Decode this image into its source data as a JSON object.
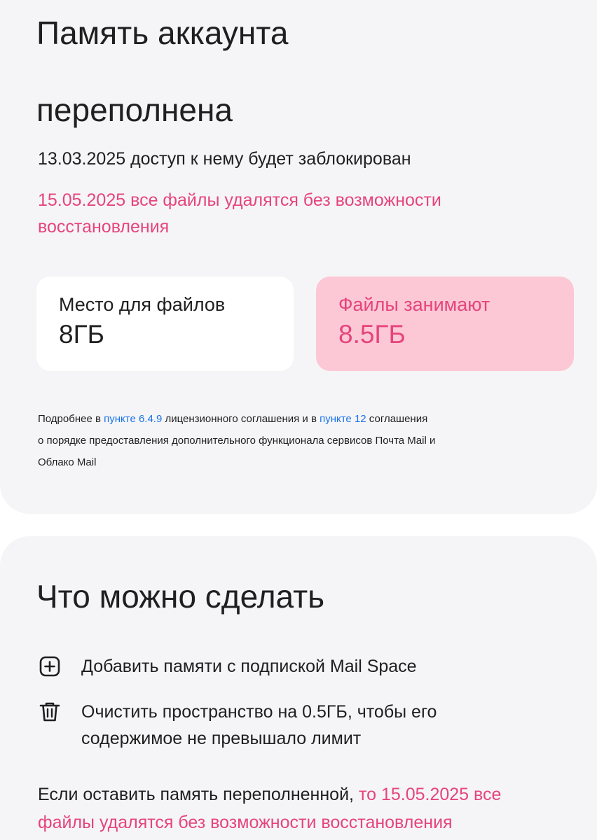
{
  "header": {
    "title_line1": "Память аккаунта",
    "title_line2": "переполнена"
  },
  "notice": {
    "block_date_text": "13.03.2025 доступ к нему будет заблокирован",
    "delete_line1": "15.05.2025 все файлы удалятся без возможности",
    "delete_line2": "восстановления"
  },
  "storage": {
    "quota_label": "Место для файлов",
    "quota_value": "8ГБ",
    "used_label": "Файлы занимают",
    "used_value": "8.5ГБ"
  },
  "fineprint": {
    "part1": "Подробнее в ",
    "link1": "пункте 6.4.9",
    "part2": " лицензионного соглашения и в ",
    "link2": "пункте 12",
    "part3": " соглашения",
    "line2": "о порядке предоставления дополнительного функционала сервисов Почта Mail и",
    "line3": "Облако Mail"
  },
  "actions": {
    "heading": "Что можно сделать",
    "items": [
      {
        "icon": "plus-square-icon",
        "label": "Добавить памяти с подпиской Mail Space"
      },
      {
        "icon": "trash-icon",
        "label_line1": "Очистить пространство на 0.5ГБ, чтобы его",
        "label_line2": "содержимое не превышало лимит"
      }
    ]
  },
  "warning": {
    "prefix": "Если оставить память переполненной, ",
    "pink_part1": "то 15.05.2025 все",
    "pink_part2": "файлы удалятся без возможности восстановления"
  },
  "colors": {
    "accent_pink": "#e6447d",
    "pink_box_bg": "#fcc8d5",
    "link_blue": "#1a73e8",
    "card_bg": "#f5f5f7"
  }
}
